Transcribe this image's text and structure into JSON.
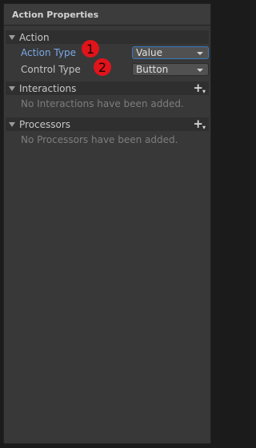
{
  "panel": {
    "title": "Action Properties"
  },
  "action_section": {
    "header": "Action",
    "action_type": {
      "label": "Action Type",
      "value": "Value"
    },
    "control_type": {
      "label": "Control Type",
      "value": "Button"
    }
  },
  "interactions_section": {
    "header": "Interactions",
    "empty_message": "No Interactions have been added."
  },
  "processors_section": {
    "header": "Processors",
    "empty_message": "No Processors have been added."
  },
  "badges": {
    "first": "1",
    "second": "2"
  },
  "colors": {
    "badge": "#e0141b",
    "active_label": "#7ba9e6",
    "focus_border": "#3a79bb"
  }
}
